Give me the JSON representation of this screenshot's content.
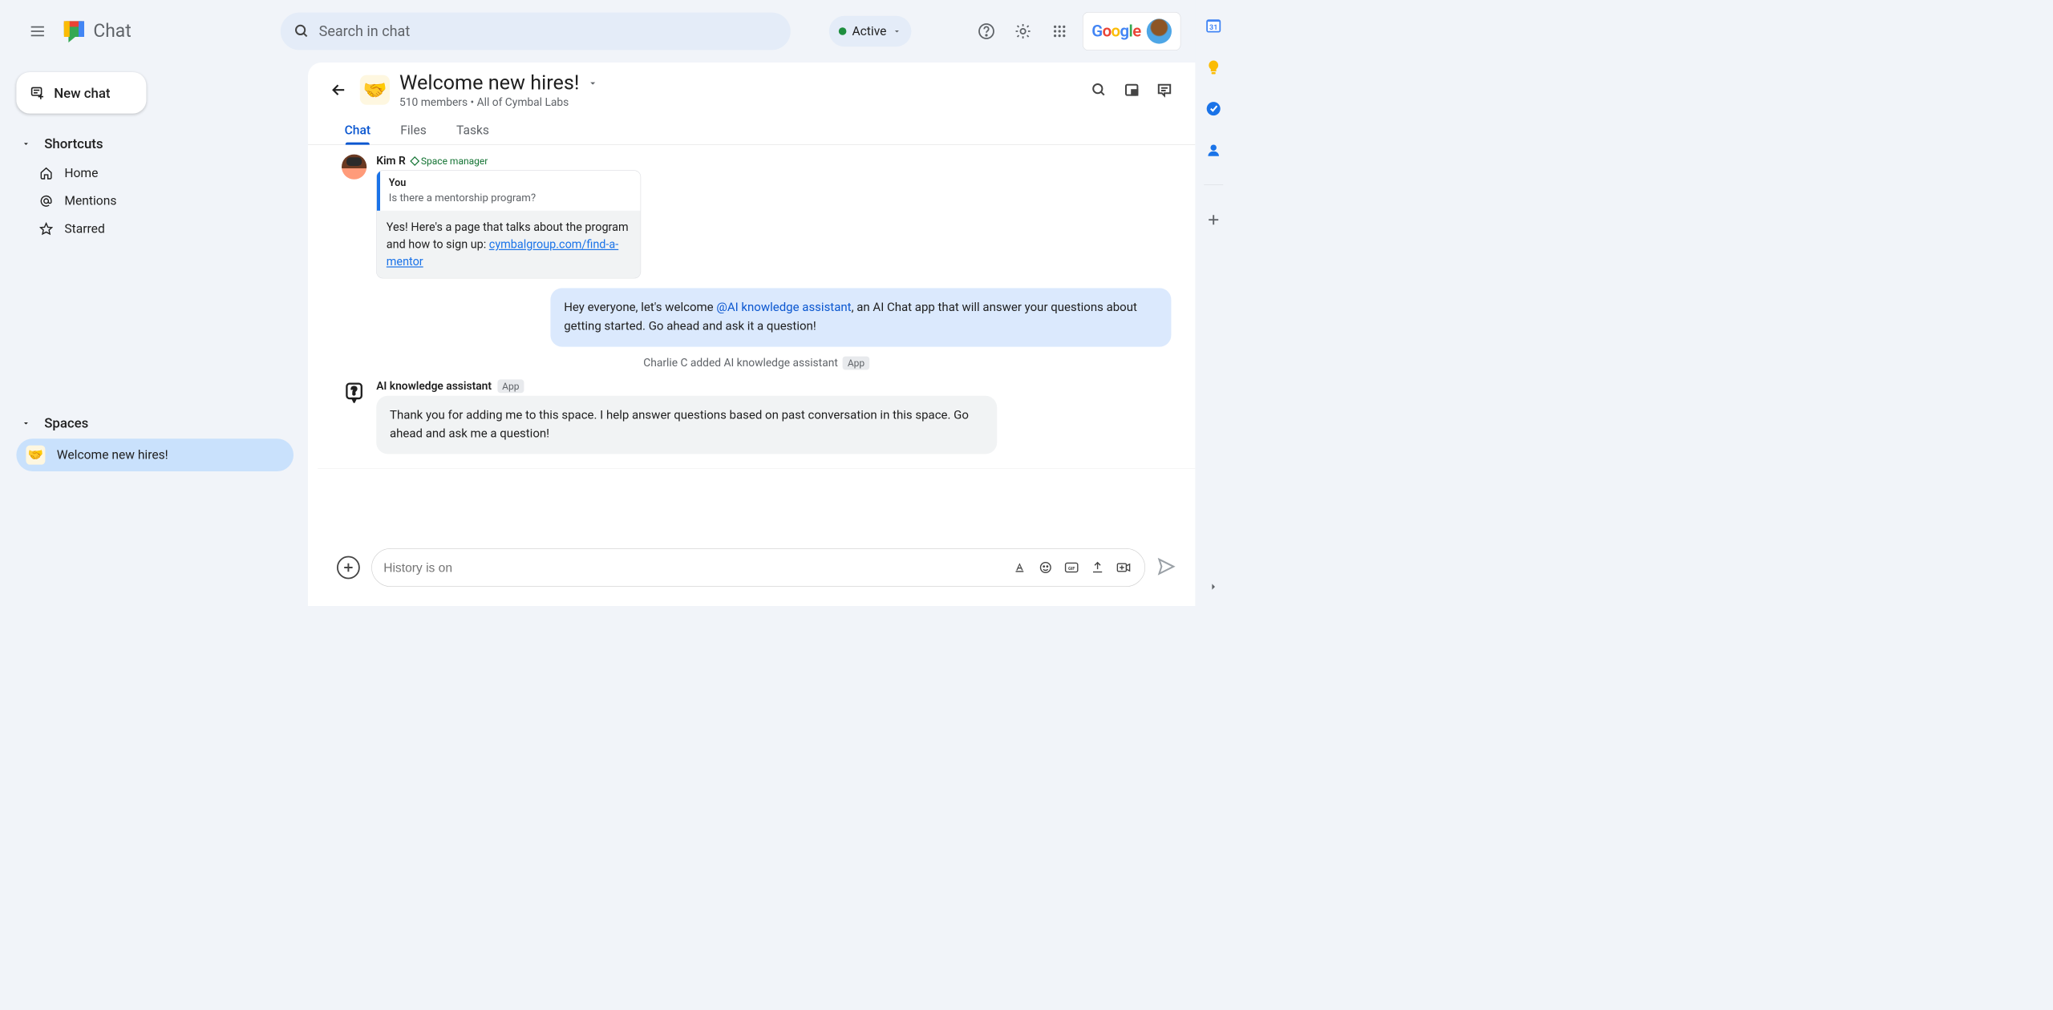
{
  "header": {
    "app_name": "Chat",
    "search_placeholder": "Search in chat",
    "status_label": "Active",
    "google_label": "Google"
  },
  "sidebar": {
    "new_chat_label": "New chat",
    "shortcuts_label": "Shortcuts",
    "shortcut_items": [
      {
        "label": "Home"
      },
      {
        "label": "Mentions"
      },
      {
        "label": "Starred"
      }
    ],
    "spaces_label": "Spaces",
    "space_items": [
      {
        "label": "Welcome new hires!",
        "emoji": "🤝",
        "selected": true
      }
    ]
  },
  "space": {
    "title": "Welcome new hires!",
    "subtitle": "510 members  •  All of Cymbal Labs",
    "tabs": [
      {
        "label": "Chat",
        "active": true
      },
      {
        "label": "Files",
        "active": false
      },
      {
        "label": "Tasks",
        "active": false
      }
    ]
  },
  "messages": {
    "msg1": {
      "author": "Kim R",
      "role": "Space manager",
      "reply_you": "You",
      "reply_question": "Is there a mentorship program?",
      "reply_body_1": "Yes! Here's a page that talks about the program and how to sign up: ",
      "reply_link": "cymbalgroup.com/find-a-mentor"
    },
    "msg2": {
      "text_1": "Hey everyone, let's welcome ",
      "mention": "@AI knowledge assistant",
      "text_2": ", an AI Chat app that will answer your questions about getting started.  Go ahead and ask it a question!"
    },
    "system": {
      "text": "Charlie C added AI knowledge assistant",
      "badge": "App"
    },
    "msg3": {
      "author": "AI knowledge assistant",
      "badge": "App",
      "body": "Thank you for adding me to this space. I help answer questions based on past conversation in this space. Go ahead and ask me a question!"
    }
  },
  "composer": {
    "placeholder": "History is on"
  }
}
